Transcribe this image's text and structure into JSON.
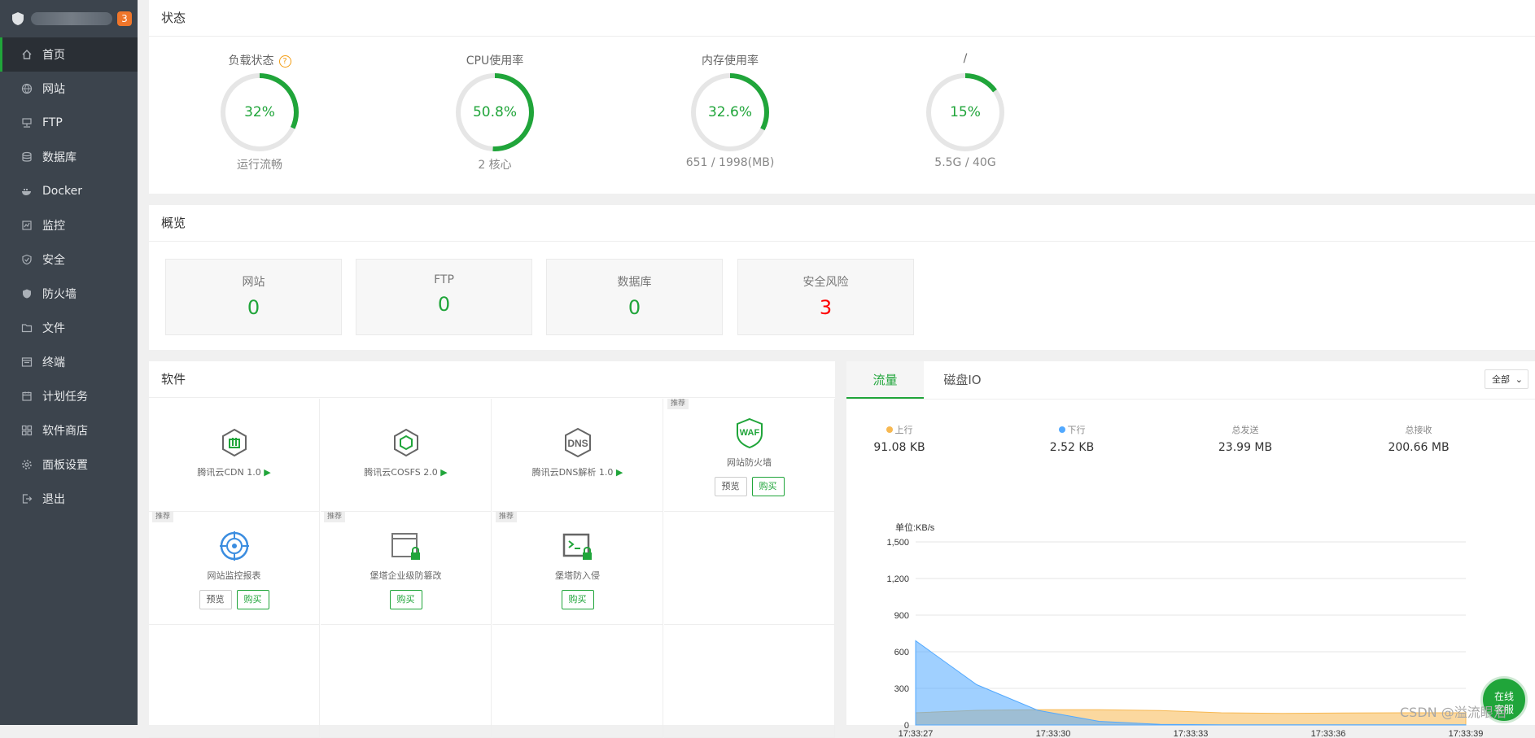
{
  "sidebar": {
    "badge": "3",
    "items": [
      {
        "label": "首页",
        "icon": "home-icon",
        "active": true
      },
      {
        "label": "网站",
        "icon": "globe-icon"
      },
      {
        "label": "FTP",
        "icon": "ftp-icon"
      },
      {
        "label": "数据库",
        "icon": "database-icon"
      },
      {
        "label": "Docker",
        "icon": "docker-icon"
      },
      {
        "label": "监控",
        "icon": "monitor-icon"
      },
      {
        "label": "安全",
        "icon": "shield-check-icon"
      },
      {
        "label": "防火墙",
        "icon": "firewall-icon"
      },
      {
        "label": "文件",
        "icon": "folder-icon"
      },
      {
        "label": "终端",
        "icon": "terminal-icon"
      },
      {
        "label": "计划任务",
        "icon": "calendar-icon"
      },
      {
        "label": "软件商店",
        "icon": "grid-icon"
      },
      {
        "label": "面板设置",
        "icon": "gear-icon"
      },
      {
        "label": "退出",
        "icon": "logout-icon"
      }
    ]
  },
  "status": {
    "title": "状态",
    "gauges": [
      {
        "label": "负载状态",
        "value": "32%",
        "percent": 32,
        "sub": "运行流畅",
        "help": "?"
      },
      {
        "label": "CPU使用率",
        "value": "50.8%",
        "percent": 50.8,
        "sub": "2 核心"
      },
      {
        "label": "内存使用率",
        "value": "32.6%",
        "percent": 32.6,
        "sub": "651 / 1998(MB)"
      },
      {
        "label": "/",
        "value": "15%",
        "percent": 15,
        "sub": "5.5G / 40G"
      }
    ]
  },
  "overview": {
    "title": "概览",
    "cards": [
      {
        "label": "网站",
        "value": "0"
      },
      {
        "label": "FTP",
        "value": "0"
      },
      {
        "label": "数据库",
        "value": "0"
      },
      {
        "label": "安全风险",
        "value": "3"
      }
    ]
  },
  "software": {
    "title": "软件",
    "tag": "推荐",
    "preview_label": "预览",
    "buy_label": "购买",
    "items": [
      {
        "name": "腾讯云CDN 1.0",
        "arrow": "▶",
        "icon": "cdn-icon"
      },
      {
        "name": "腾讯云COSFS 2.0",
        "arrow": "▶",
        "icon": "cosfs-icon"
      },
      {
        "name": "腾讯云DNS解析 1.0",
        "arrow": "▶",
        "icon": "dns-icon",
        "icon_text": "DNS"
      },
      {
        "name": "网站防火墙",
        "icon": "waf-icon",
        "icon_text": "WAF",
        "recommended": true,
        "preview": true,
        "buy": true
      },
      {
        "name": "网站监控报表",
        "icon": "monitor-report-icon",
        "recommended": true,
        "preview": true,
        "buy": true
      },
      {
        "name": "堡塔企业级防篡改",
        "icon": "tamper-proof-icon",
        "recommended": true,
        "buy": true
      },
      {
        "name": "堡塔防入侵",
        "icon": "intrusion-icon",
        "recommended": true,
        "buy": true
      }
    ]
  },
  "traffic": {
    "tabs": [
      "流量",
      "磁盘IO"
    ],
    "select": "全部",
    "stats": [
      {
        "label": "上行",
        "value": "91.08 KB",
        "color": "#f7b851"
      },
      {
        "label": "下行",
        "value": "2.52 KB",
        "color": "#52a9ff"
      },
      {
        "label": "总发送",
        "value": "23.99 MB"
      },
      {
        "label": "总接收",
        "value": "200.66 MB"
      }
    ]
  },
  "chart_data": {
    "type": "area",
    "unit_label": "单位:KB/s",
    "ylim": [
      0,
      1500
    ],
    "yticks": [
      "0",
      "300",
      "600",
      "900",
      "1,200",
      "1,500"
    ],
    "x": [
      "17:33:27",
      "17:33:30",
      "17:33:33",
      "17:33:36",
      "17:33:39"
    ],
    "series": [
      {
        "name": "上行",
        "color": "#f7b851",
        "values": [
          100,
          120,
          125,
          125,
          118,
          100,
          95,
          98,
          100,
          100
        ]
      },
      {
        "name": "下行",
        "color": "#52a9ff",
        "values": [
          690,
          330,
          120,
          30,
          5,
          2,
          2,
          2,
          2,
          2
        ]
      }
    ],
    "grid": true
  },
  "fab": {
    "line1": "在线",
    "line2": "客服"
  },
  "watermark": "CSDN @溢流眼泪"
}
